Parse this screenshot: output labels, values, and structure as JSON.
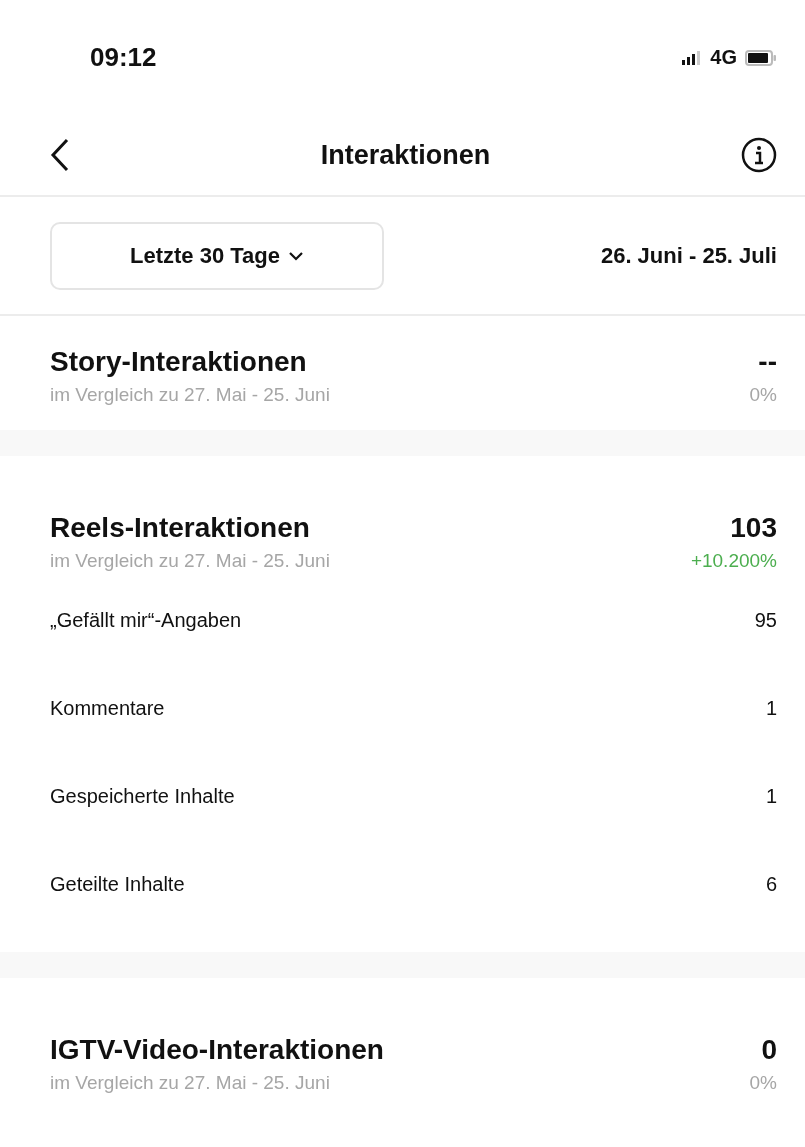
{
  "status_bar": {
    "time": "09:12",
    "network": "4G"
  },
  "header": {
    "title": "Interaktionen"
  },
  "filter": {
    "period": "Letzte 30 Tage",
    "range": "26. Juni - 25. Juli"
  },
  "sections": [
    {
      "title": "Story-Interaktionen",
      "comparison": "im Vergleich zu 27. Mai - 25. Juni",
      "value": "--",
      "change": "0%",
      "color": "#a6a6a6"
    },
    {
      "title": "Reels-Interaktionen",
      "comparison": "im Vergleich zu 27. Mai - 25. Juni",
      "value": "103",
      "change": "+10.200%",
      "color": "#4cae4f",
      "rows": [
        {
          "label": "„Gefällt mir“-Angaben",
          "value": "95"
        },
        {
          "label": "Kommentare",
          "value": "1"
        },
        {
          "label": "Gespeicherte Inhalte",
          "value": "1"
        },
        {
          "label": "Geteilte Inhalte",
          "value": "6"
        }
      ]
    },
    {
      "title": "IGTV-Video-Interaktionen",
      "comparison": "im Vergleich zu 27. Mai - 25. Juni",
      "value": "0",
      "change": "0%",
      "color": "#a6a6a6"
    }
  ]
}
